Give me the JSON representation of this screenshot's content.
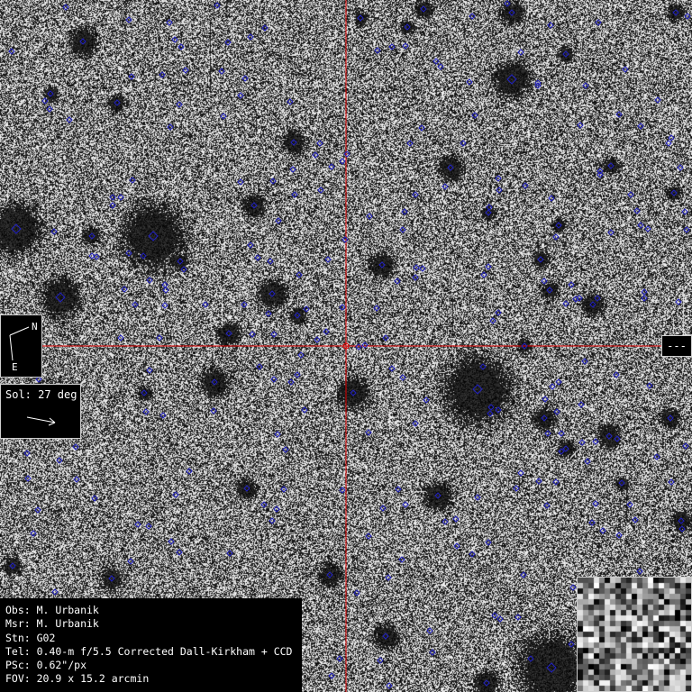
{
  "compass": {
    "north_label": "N",
    "east_label": "E"
  },
  "motion": {
    "text": "Sol: 27 deg"
  },
  "magnitude_box": {
    "text": "---"
  },
  "info": {
    "observer": "Obs: M. Urbanik",
    "measurer": "Msr: M. Urbanik",
    "station": "Stn: G02",
    "telescope": "Tel: 0.40-m f/5.5 Corrected Dall-Kirkham + CCD",
    "pixel_scale": "PSc: 0.62\"/px",
    "field_of_view": "FOV: 20.9 x 15.2 arcmin"
  },
  "colors": {
    "crosshair": "#e00000",
    "marker": "#2020c0",
    "panel_bg": "#000000",
    "panel_text": "#ffffff"
  },
  "icons": [
    "compass-icon",
    "motion-arrow-icon",
    "crosshair",
    "star-marker"
  ]
}
